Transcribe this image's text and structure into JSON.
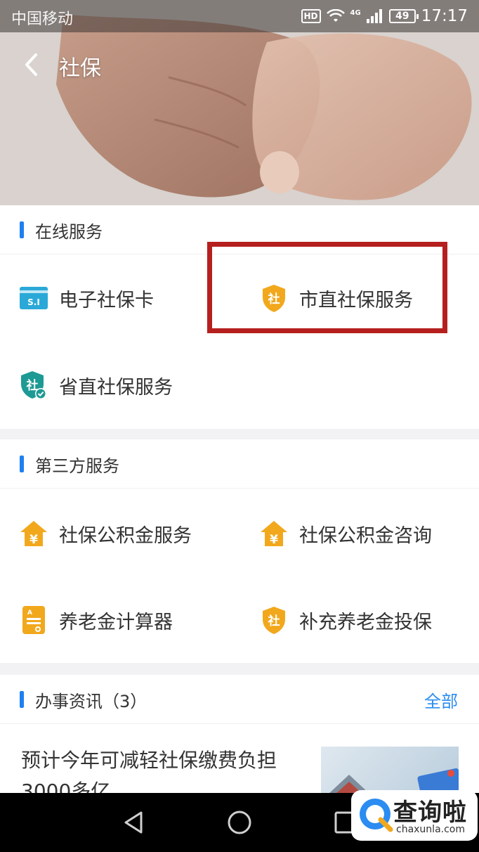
{
  "status_bar": {
    "carrier": "中国移动",
    "hd": "HD",
    "network": "4G",
    "battery": "49",
    "time": "17:17"
  },
  "header": {
    "title": "社保"
  },
  "online_services": {
    "title": "在线服务",
    "items": [
      {
        "label": "电子社保卡",
        "icon": "si-card-icon"
      },
      {
        "label": "市直社保服务",
        "icon": "she-shield-icon"
      },
      {
        "label": "省直社保服务",
        "icon": "she-shield-verified-icon"
      }
    ]
  },
  "third_party_services": {
    "title": "第三方服务",
    "items": [
      {
        "label": "社保公积金服务",
        "icon": "yuan-house-icon"
      },
      {
        "label": "社保公积金咨询",
        "icon": "yuan-house-icon"
      },
      {
        "label": "养老金计算器",
        "icon": "calculator-doc-icon"
      },
      {
        "label": "补充养老金投保",
        "icon": "she-shield-icon"
      }
    ]
  },
  "news": {
    "title": "办事资讯（3）",
    "more": "全部",
    "items": [
      {
        "title": "预计今年可减轻社保缴费负担3000多亿"
      }
    ]
  },
  "watermark": {
    "brand": "查询啦",
    "domain": "chaxunla.com"
  },
  "colors": {
    "accent_blue": "#1e7ff0",
    "icon_gold": "#f2a81d",
    "icon_teal": "#1d9a94",
    "highlight_red": "#b5201f"
  }
}
